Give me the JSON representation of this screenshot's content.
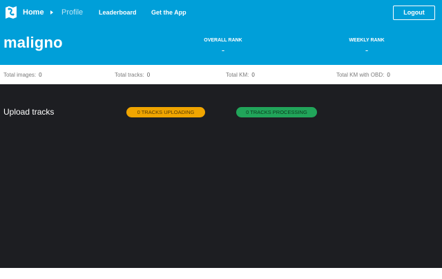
{
  "nav": {
    "home": "Home",
    "profile": "Profile",
    "leaderboard": "Leaderboard",
    "get_app": "Get the App",
    "logout": "Logout"
  },
  "profile": {
    "username": "maligno",
    "overall_rank_label": "OVERALL RANK",
    "overall_rank_value": "-",
    "weekly_rank_label": "WEEKLY RANK",
    "weekly_rank_value": "-"
  },
  "stats": [
    {
      "label": "Total images:",
      "value": "0"
    },
    {
      "label": "Total tracks:",
      "value": "0"
    },
    {
      "label": "Total KM:",
      "value": "0"
    },
    {
      "label": "Total KM with OBD:",
      "value": "0"
    }
  ],
  "upload": {
    "title": "Upload tracks",
    "uploading": "0 TRACKS UPLOADING",
    "processing": "0 TRACKS PROCESSING"
  },
  "colors": {
    "header": "#009fd9",
    "dark_panel": "#1d1e22",
    "uploading": "#f0a500",
    "processing": "#21a55a"
  },
  "icons": {
    "logo": "map-logo-icon",
    "separator": "chevron-right-icon"
  }
}
